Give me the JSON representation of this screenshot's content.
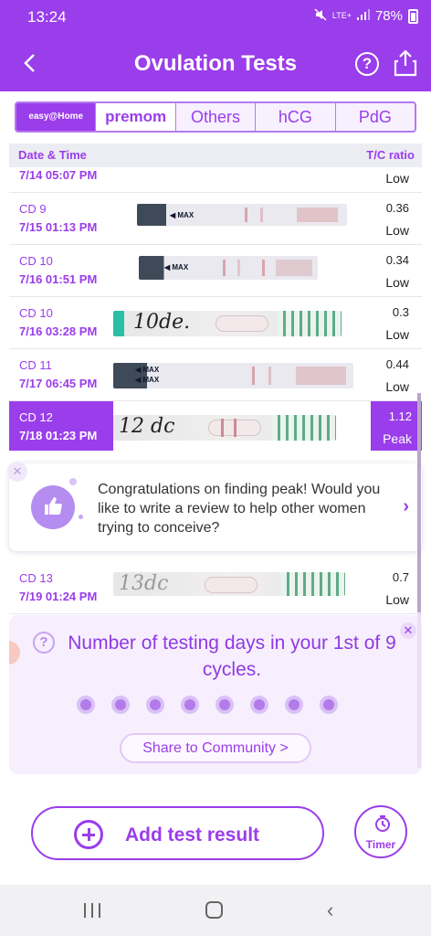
{
  "status_bar": {
    "time": "13:24",
    "network": "LTE+",
    "battery": "78%"
  },
  "header": {
    "title": "Ovulation Tests",
    "back_icon": "chevron-left-icon",
    "help_label": "?",
    "share_icon": "share-icon"
  },
  "brand_tabs": [
    {
      "label": "easy@Home"
    },
    {
      "label": "premom"
    },
    {
      "label": "Others"
    },
    {
      "label": "hCG"
    },
    {
      "label": "PdG"
    }
  ],
  "table": {
    "col_left": "Date & Time",
    "col_right": "T/C ratio",
    "rows": [
      {
        "cd": "",
        "datetime": "7/14  05:07 PM",
        "ratio": "",
        "level": "Low",
        "strip": "gray"
      },
      {
        "cd": "CD 9",
        "datetime": "7/15  01:13 PM",
        "ratio": "0.36",
        "level": "Low",
        "strip": "dark"
      },
      {
        "cd": "CD 10",
        "datetime": "7/16  01:51 PM",
        "ratio": "0.34",
        "level": "Low",
        "strip": "dark"
      },
      {
        "cd": "CD 10",
        "datetime": "7/16  03:28 PM",
        "ratio": "0.3",
        "level": "Low",
        "strip": "photo",
        "hand": "10de."
      },
      {
        "cd": "CD 11",
        "datetime": "7/17  06:45 PM",
        "ratio": "0.44",
        "level": "Low",
        "strip": "dark"
      },
      {
        "cd": "CD 12",
        "datetime": "7/18  01:23 PM",
        "ratio": "1.12",
        "level": "Peak",
        "strip": "photo",
        "hand": "12 dc",
        "peak": true
      }
    ],
    "row_cd13": {
      "cd": "CD 13",
      "datetime": "7/19  01:24 PM",
      "ratio": "0.7",
      "level": "Low",
      "hand": "13dc"
    }
  },
  "review_card": {
    "text": "Congratulations on finding peak! Would you like to write a review to help other women trying to conceive?",
    "close_icon": "close-icon",
    "arrow_icon": "chevron-right-icon"
  },
  "cycle_card": {
    "title": "Number of testing days in your 1st of 9 cycles.",
    "dots": 8,
    "share_label": "Share to Community  >",
    "help_label": "?"
  },
  "actions": {
    "add_label": "Add test result",
    "timer_label": "Timer"
  },
  "colors": {
    "accent": "#9a3dea",
    "peak_bg": "#9a3dea",
    "card_bg": "#f7effd"
  }
}
